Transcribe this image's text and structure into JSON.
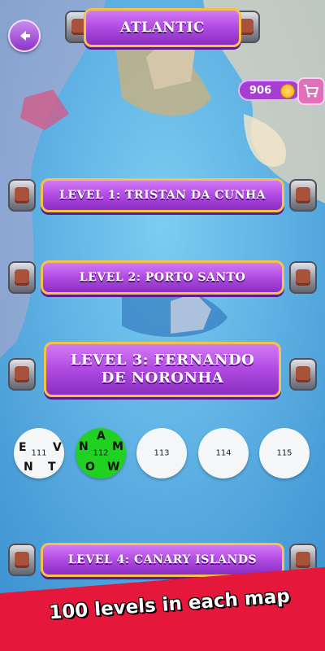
{
  "header": {
    "title": "ATLANTIC",
    "back_icon": "back-arrow-icon"
  },
  "currency": {
    "coins": "906",
    "coin_icon": "coin-icon",
    "cart_icon": "cart-icon"
  },
  "levels": [
    {
      "label": "LEVEL 1: TRISTAN DA CUNHA"
    },
    {
      "label": "LEVEL 2: PORTO SANTO"
    },
    {
      "label": "LEVEL 3: FERNANDO DE NORONHA"
    },
    {
      "label": "LEVEL 4: CANARY ISLANDS"
    }
  ],
  "sublevels": [
    {
      "number": "111",
      "letters": [
        "E",
        "V",
        "N",
        "T"
      ],
      "state": "completed"
    },
    {
      "number": "112",
      "letters": [
        "A",
        "N",
        "M",
        "O",
        "W"
      ],
      "state": "current",
      "color": "#21d121"
    },
    {
      "number": "113",
      "letters": [],
      "state": "locked"
    },
    {
      "number": "114",
      "letters": [],
      "state": "locked"
    },
    {
      "number": "115",
      "letters": [],
      "state": "locked"
    }
  ],
  "footer": {
    "text": "100 levels in each map",
    "color": "#e5173a"
  },
  "colors": {
    "banner": "#b34ee4",
    "banner_border": "#f4c24a",
    "sea": "#5fb6e6"
  }
}
